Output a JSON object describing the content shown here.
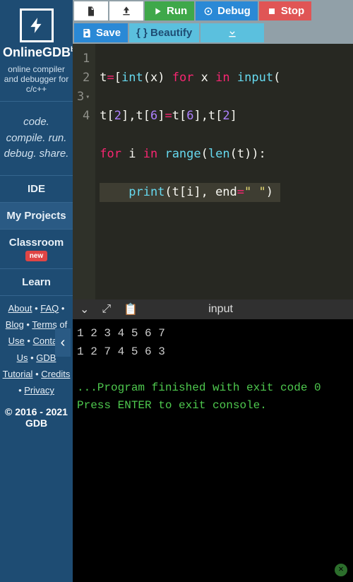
{
  "brand": {
    "name": "OnlineGDB",
    "beta": "beta"
  },
  "tagline": "online compiler and debugger for c/c++",
  "slogan": "code. compile. run. debug. share.",
  "nav": {
    "ide": "IDE",
    "projects": "My Projects",
    "classroom": "Classroom",
    "new": "new",
    "learn": "Learn"
  },
  "footer": {
    "about": "About",
    "faq": "FAQ",
    "blog": "Blog",
    "terms": "Terms of Use",
    "contact": "Contact Us",
    "tutorial": "GDB Tutorial",
    "credits": "Credits",
    "privacy": "Privacy"
  },
  "copyright": "© 2016 - 2021 GDB",
  "toolbar": {
    "run": "Run",
    "debug": "Debug",
    "stop": "Stop",
    "save": "Save",
    "beautify": "{ } Beautify"
  },
  "code": {
    "lines": [
      "1",
      "2",
      "3",
      "4"
    ],
    "l1": {
      "a": "t",
      "b": "=",
      "c": "[",
      "d": "int",
      "e": "(x) ",
      "f": "for",
      "g": " x ",
      "h": "in",
      "i": " ",
      "j": "input",
      "k": "("
    },
    "l2": {
      "a": "t[",
      "b": "2",
      "c": "],t[",
      "d": "6",
      "e": "]",
      "f": "=",
      "g": "t[",
      "h": "6",
      "i": "],t[",
      "j": "2",
      "k": "]"
    },
    "l3": {
      "a": "for",
      "b": " i ",
      "c": "in",
      "d": " ",
      "e": "range",
      "f": "(",
      "g": "len",
      "h": "(t)):"
    },
    "l4": {
      "a": "    ",
      "b": "print",
      "c": "(t[i], end",
      "d": "=",
      "e": "\" \"",
      "f": ")"
    }
  },
  "io_label": "input",
  "console": {
    "in1": "1  2  3  4  5  6  7",
    "out1": "1  2  7  4  5  6  3",
    "msg1": "...Program finished with exit code 0",
    "msg2": "Press ENTER to exit console."
  },
  "chart_data": null
}
